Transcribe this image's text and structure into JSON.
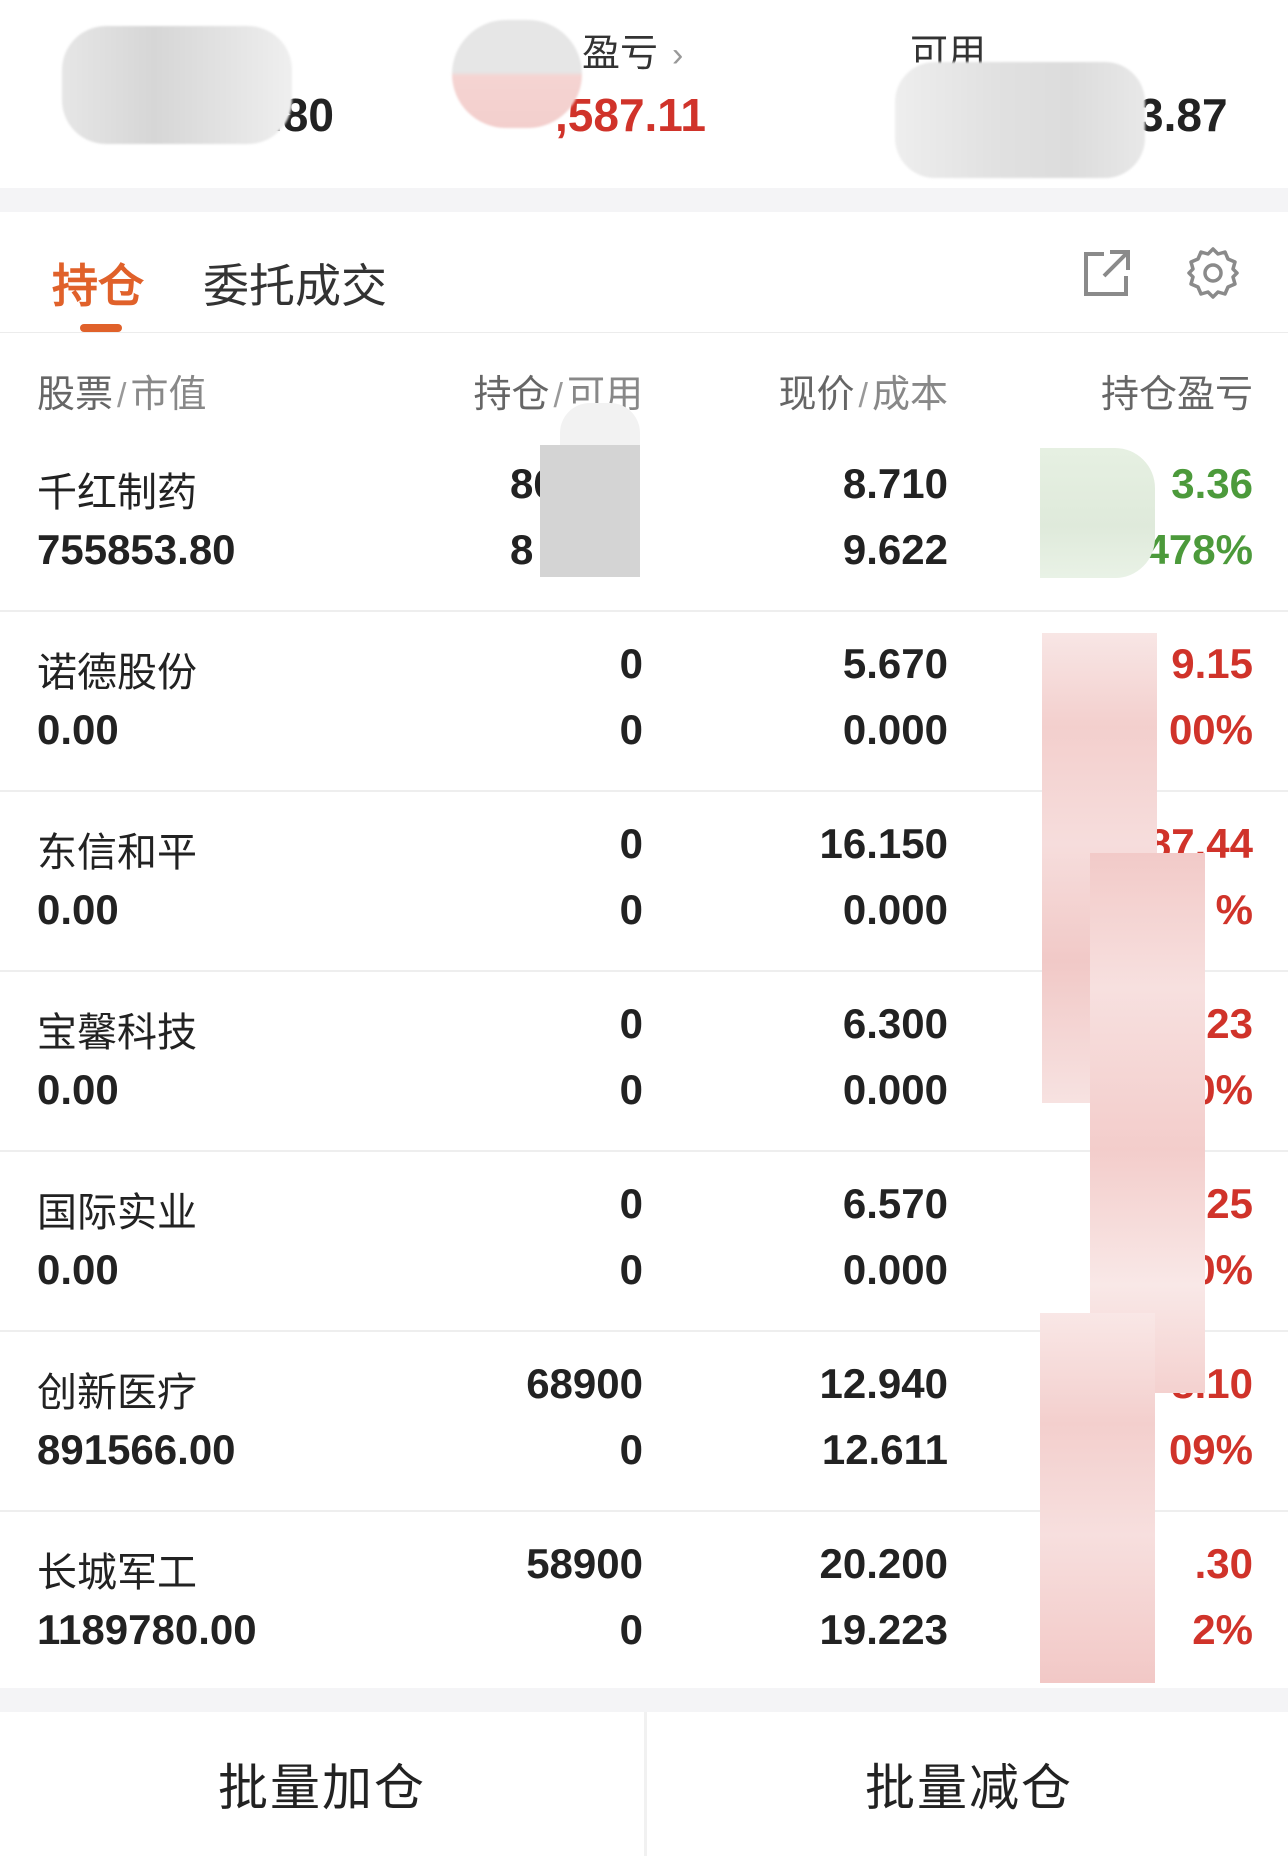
{
  "summary": {
    "left_value": ".80",
    "pnl_label": "盈亏",
    "pnl_arrow": "›",
    "pnl_value": ",587.11",
    "available_label": "可用",
    "available_value": "3.87"
  },
  "tabs": {
    "positions": "持仓",
    "orders": "委托成交"
  },
  "icons": {
    "export": "export-icon",
    "settings": "gear-icon"
  },
  "table": {
    "headers": {
      "col1_a": "股票",
      "col1_b": "市值",
      "col2_a": "持仓",
      "col2_b": "可用",
      "col3_a": "现价",
      "col3_b": "成本",
      "col4_a": "持仓盈亏"
    },
    "rows": [
      {
        "name": "千红制药",
        "market_value": "755853.80",
        "hold": "86",
        "avail": "8",
        "price": "8.710",
        "cost": "9.622",
        "pnl": "3.36",
        "pnl_pct": ".478%",
        "tone": "green"
      },
      {
        "name": "诺德股份",
        "market_value": "0.00",
        "hold": "0",
        "avail": "0",
        "price": "5.670",
        "cost": "0.000",
        "pnl": "9.15",
        "pnl_pct": "00%",
        "tone": "red"
      },
      {
        "name": "东信和平",
        "market_value": "0.00",
        "hold": "0",
        "avail": "0",
        "price": "16.150",
        "cost": "0.000",
        "pnl": "87.44",
        "pnl_pct": "%",
        "tone": "red"
      },
      {
        "name": "宝馨科技",
        "market_value": "0.00",
        "hold": "0",
        "avail": "0",
        "price": "6.300",
        "cost": "0.000",
        "pnl": "23",
        "pnl_pct": "0%",
        "tone": "red"
      },
      {
        "name": "国际实业",
        "market_value": "0.00",
        "hold": "0",
        "avail": "0",
        "price": "6.570",
        "cost": "0.000",
        "pnl": ".25",
        "pnl_pct": "0%",
        "tone": "red"
      },
      {
        "name": "创新医疗",
        "market_value": "891566.00",
        "hold": "68900",
        "avail": "0",
        "price": "12.940",
        "cost": "12.611",
        "pnl": "8.10",
        "pnl_pct": "09%",
        "tone": "red"
      },
      {
        "name": "长城军工",
        "market_value": "1189780.00",
        "hold": "58900",
        "avail": "0",
        "price": "20.200",
        "cost": "19.223",
        "pnl": ".30",
        "pnl_pct": "2%",
        "tone": "red"
      }
    ]
  },
  "buttons": {
    "batch_add": "批量加仓",
    "batch_reduce": "批量减仓"
  },
  "colors": {
    "accent": "#e0612a",
    "loss_green": "#4c9a3b",
    "profit_red": "#d0332a"
  }
}
